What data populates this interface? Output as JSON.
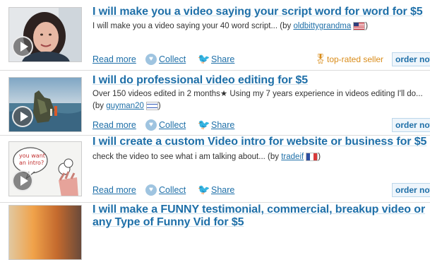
{
  "gigs": [
    {
      "title": "I will make you a video saying your script word for word for $5",
      "desc": "I will make you a video saying your 40 word script...",
      "by_prefix": "(by",
      "user": "oldbittygrandma",
      "by_suffix": ")",
      "read_more": "Read more",
      "collect": "Collect",
      "share": "Share",
      "top_rated": "top-rated seller",
      "order": "order now"
    },
    {
      "title": "I will do professional video editing for $5",
      "desc": "Over 150 videos edited in 2 months★ Using my 7 years experience in videos editing I'll do...",
      "by_prefix": "(by",
      "user": "guyman20",
      "by_suffix": ")",
      "read_more": "Read more",
      "collect": "Collect",
      "share": "Share",
      "order": "order now"
    },
    {
      "title": "I will create a custom Video intro for website or business for $5",
      "desc": "check the video to see what i am talking about...",
      "by_prefix": "(by",
      "user": "tradeif",
      "by_suffix": ")",
      "read_more": "Read more",
      "collect": "Collect",
      "share": "Share",
      "order": "order now",
      "thumb_text": "you want an intro?"
    },
    {
      "title": "I will make a FUNNY testimonial, commercial, breakup video or",
      "title_line2": "any Type of Funny Vid for $5"
    }
  ],
  "colors": {
    "link": "#1e6fa8",
    "accent": "#d98c1a"
  },
  "icons": {
    "play": "play-icon",
    "heart": "heart-icon",
    "share": "twitter-bird-icon",
    "badge": "medal-icon"
  }
}
